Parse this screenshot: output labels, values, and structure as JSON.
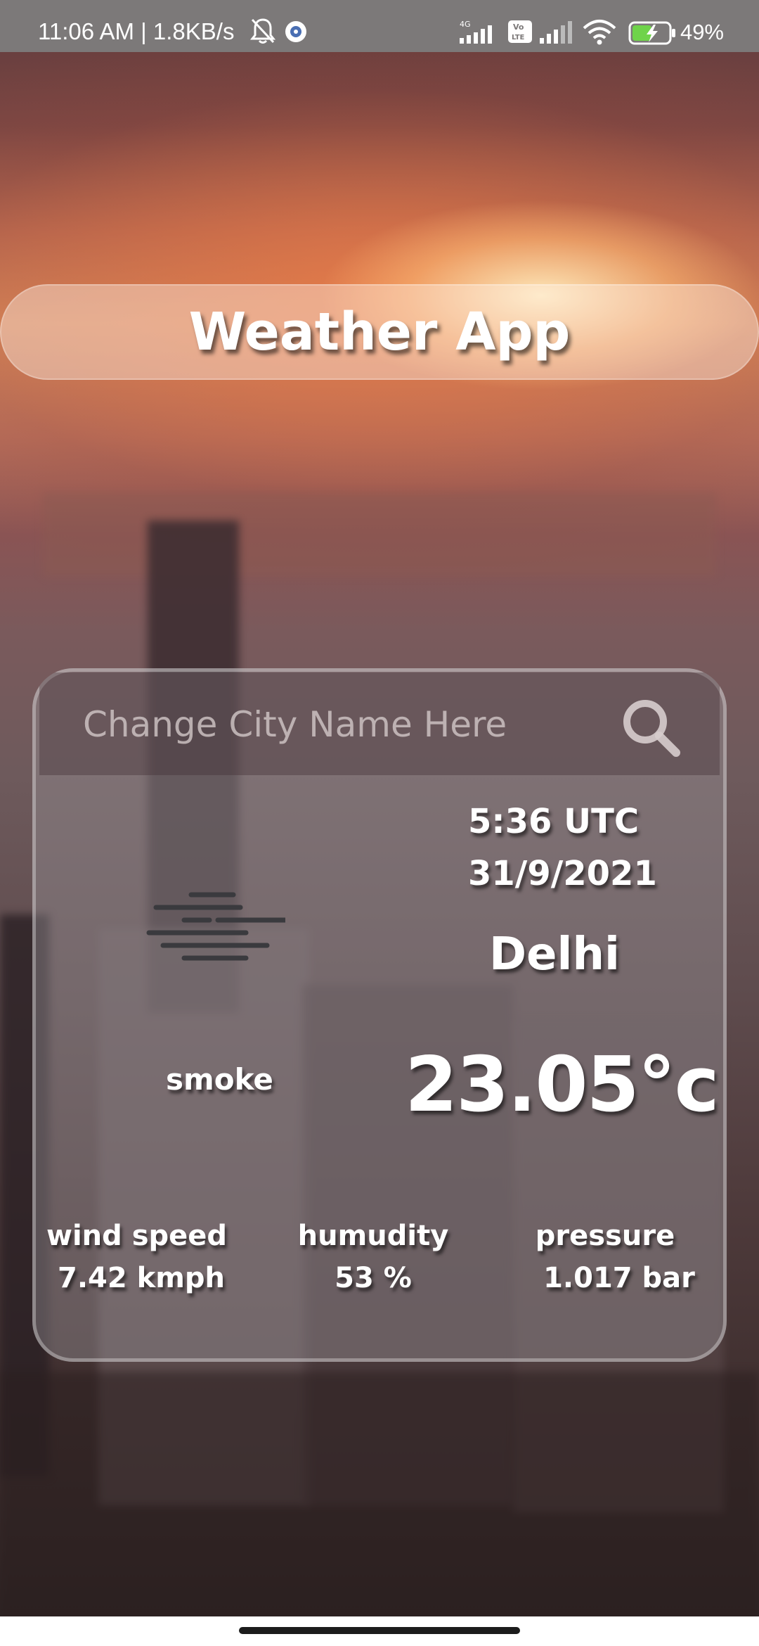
{
  "status_bar": {
    "time": "11:06 AM | 1.8KB/s",
    "battery": "49%",
    "icons": [
      "bell-off-icon",
      "app-notification-icon",
      "signal-4g-icon",
      "volte-icon",
      "signal-icon",
      "wifi-icon",
      "battery-charging-icon"
    ]
  },
  "header": {
    "title": "Weather App"
  },
  "search": {
    "placeholder": "Change City Name Here",
    "value": "",
    "icon": "search-icon"
  },
  "weather": {
    "time": "5:36 UTC",
    "date": "31/9/2021",
    "city": "Delhi",
    "condition": "smoke",
    "condition_icon": "smoke-haze-icon",
    "temperature": "23.05°c"
  },
  "stats": {
    "wind_label": "wind speed",
    "wind_value": "7.42 kmph",
    "humidity_label": "humudity",
    "humidity_value": "53 %",
    "pressure_label": "pressure",
    "pressure_value": "1.017 bar"
  },
  "colors": {
    "status_bar_bg": "#7c7979",
    "text": "#ffffff",
    "battery_green": "#6fd34a"
  }
}
